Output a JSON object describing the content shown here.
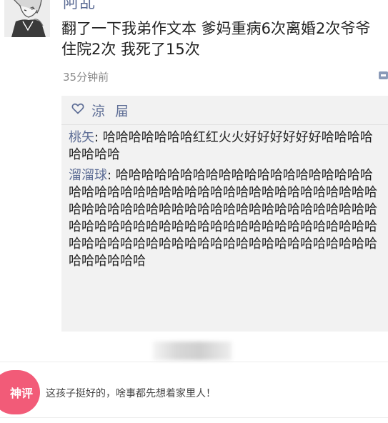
{
  "post": {
    "username": "阿乱",
    "text": "翻了一下我弟作文本 爹妈重病6次离婚2次爷爷住院2次 我死了15次",
    "time": "35分钟前",
    "likes": {
      "names": "涼 屇"
    },
    "comments": [
      {
        "author": "桃矢",
        "text": "哈哈哈哈哈哈哈红红火火好好好好好好哈哈哈哈哈哈哈哈"
      },
      {
        "author": "溜溜球",
        "text": "哈哈哈哈哈哈哈哈哈哈哈哈哈哈哈哈哈哈哈哈哈哈哈哈哈哈哈哈哈哈哈哈哈哈哈哈哈哈哈哈哈哈哈哈哈哈哈哈哈哈哈哈哈哈哈哈哈哈哈哈哈哈哈哈哈哈哈哈哈哈哈哈哈哈哈哈哈哈哈哈哈哈哈哈哈哈哈哈哈哈哈哈哈哈哈哈哈哈哈哈哈哈哈哈哈哈哈哈哈哈哈哈哈哈哈哈哈哈哈哈哈哈"
      }
    ]
  },
  "hot_comment": {
    "badge": "神评",
    "text": "这孩子挺好的，啥事都先想着家里人！"
  },
  "icons": {
    "like": "heart-outline-icon",
    "more": "more-options-icon",
    "avatar": "anime-avatar"
  },
  "colors": {
    "link": "#5b6b94",
    "badge": "#f25b78",
    "comment_bg": "#f2f2f2"
  }
}
